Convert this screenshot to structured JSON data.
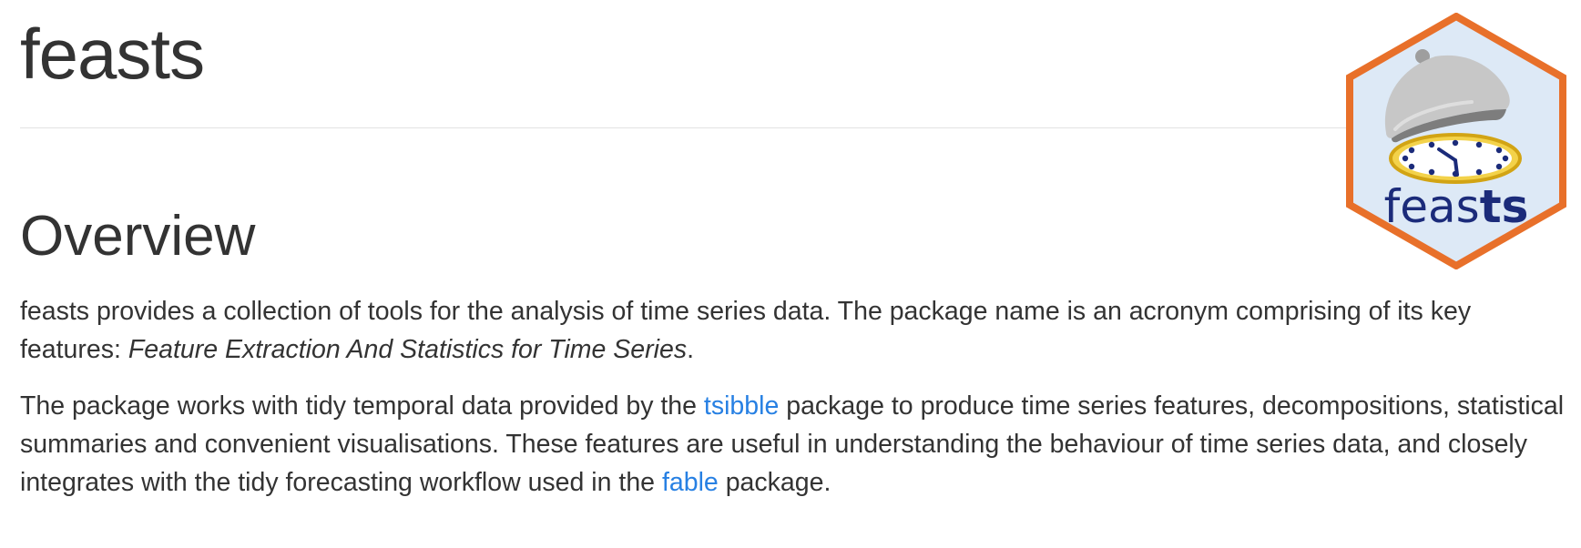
{
  "page": {
    "title": "feasts"
  },
  "overview": {
    "heading": "Overview",
    "para1": {
      "text": "feasts provides a collection of tools for the analysis of time series data. The package name is an acronym comprising of its key features:",
      "emphasis": "Feature Extraction And Statistics for Time Series",
      "end": "."
    },
    "para2": {
      "before_link1": "The package works with tidy temporal data provided by the",
      "link1": "tsibble",
      "between_links": "package to produce time series features, decompositions, statistical summaries and convenient visualisations. These features are useful in understanding the behaviour of time series data, and closely integrates with the tidy forecasting workflow used in the",
      "link2": "fable",
      "after_link2": "package."
    }
  },
  "logo": {
    "wordmark_light": "feas",
    "wordmark_bold": "ts",
    "icon": "cloche-clock-hex-logo",
    "border_color": "#e8702a",
    "fill_color": "#dde9f6",
    "text_color": "#1b2b7a",
    "link_color": "#2780e3"
  }
}
